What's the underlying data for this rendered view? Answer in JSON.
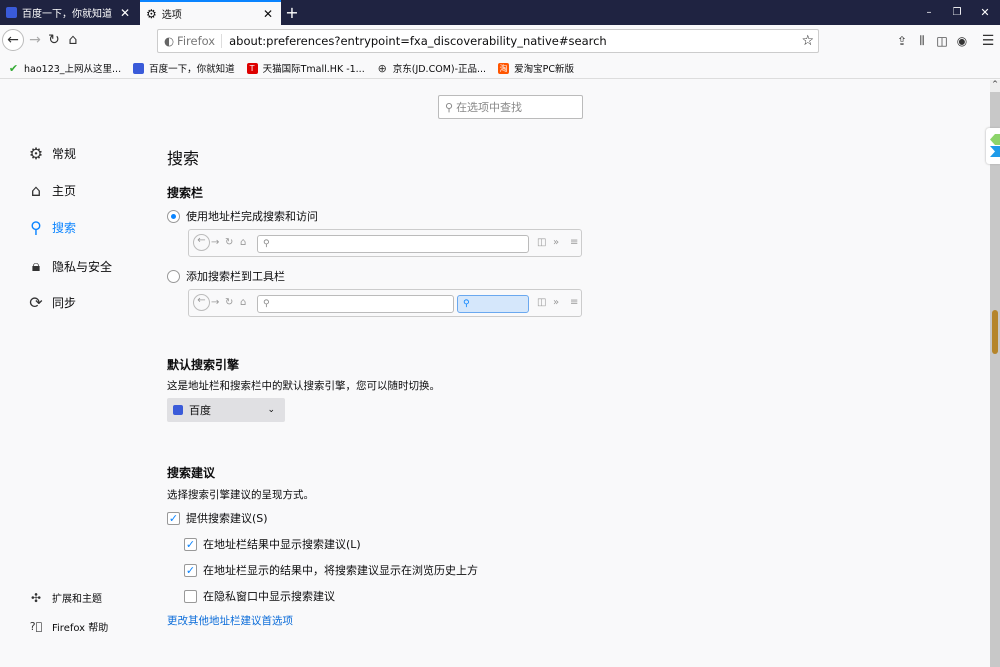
{
  "tabs": [
    {
      "title": "百度一下，你就知道",
      "icon": "baidu-icon"
    },
    {
      "title": "选项",
      "icon": "gear-icon"
    }
  ],
  "window": {
    "minimize": "–",
    "restore": "❐",
    "close": "✕"
  },
  "urlbar": {
    "identity": "Firefox",
    "url": "about:preferences?entrypoint=fxa_discoverability_native#search"
  },
  "bookmarks": [
    "hao123_上网从这里...",
    "百度一下，你就知道",
    "天猫国际Tmall.HK -1...",
    "京东(JD.COM)-正品...",
    "爱淘宝PC新版"
  ],
  "search_prefs": {
    "placeholder": "在选项中查找"
  },
  "sidebar": {
    "items": [
      {
        "label": "常规"
      },
      {
        "label": "主页"
      },
      {
        "label": "搜索"
      },
      {
        "label": "隐私与安全"
      },
      {
        "label": "同步"
      }
    ],
    "footer": [
      {
        "label": "扩展和主题"
      },
      {
        "label": "Firefox 帮助"
      }
    ]
  },
  "main": {
    "title": "搜索",
    "searchbar": {
      "heading": "搜索栏",
      "opt1": "使用地址栏完成搜索和访问",
      "opt2": "添加搜索栏到工具栏"
    },
    "engine": {
      "heading": "默认搜索引擎",
      "desc": "这是地址栏和搜索栏中的默认搜索引擎，您可以随时切换。",
      "selected": "百度"
    },
    "suggest": {
      "heading": "搜索建议",
      "desc": "选择搜索引擎建议的呈现方式。",
      "c1": "提供搜索建议(S)",
      "c2": "在地址栏结果中显示搜索建议(L)",
      "c3": "在地址栏显示的结果中，将搜索建议显示在浏览历史上方",
      "c4": "在隐私窗口中显示搜索建议",
      "link": "更改其他地址栏建议首选项"
    }
  },
  "colors": {
    "accent": "#0a84ff",
    "titlebar": "#1f2341"
  }
}
